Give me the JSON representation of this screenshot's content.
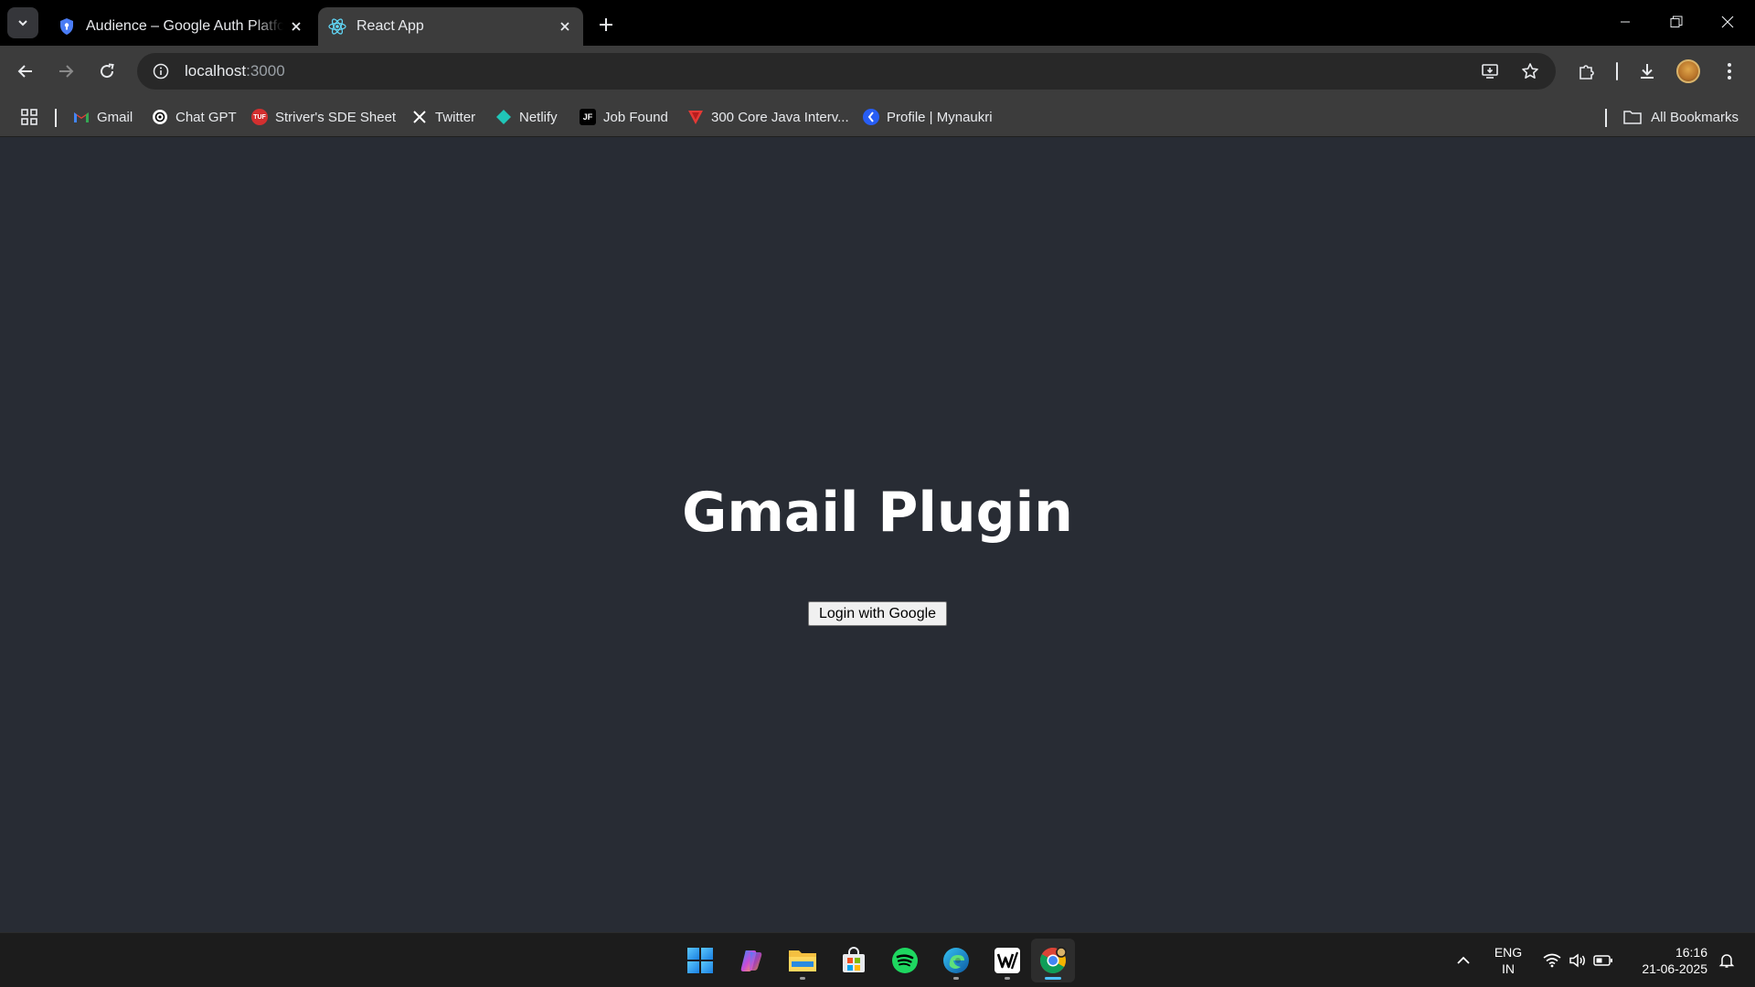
{
  "browser": {
    "tabs": [
      {
        "title": "Audience – Google Auth Platform",
        "favicon": "shield-icon",
        "active": false
      },
      {
        "title": "React App",
        "favicon": "react-icon",
        "active": true
      }
    ],
    "url_host": "localhost",
    "url_port": ":3000",
    "bookmarks": [
      {
        "label": "Gmail",
        "icon": "gmail-icon"
      },
      {
        "label": "Chat GPT",
        "icon": "chatgpt-icon"
      },
      {
        "label": "Striver's SDE Sheet",
        "icon": "tuf-icon"
      },
      {
        "label": "Twitter",
        "icon": "x-icon"
      },
      {
        "label": "Netlify",
        "icon": "netlify-icon"
      },
      {
        "label": "Job Found",
        "icon": "jf-icon"
      },
      {
        "label": "300 Core Java Interv...",
        "icon": "java-icon"
      },
      {
        "label": "Profile | Mynaukri",
        "icon": "naukri-icon"
      }
    ],
    "all_bookmarks": "All Bookmarks"
  },
  "page": {
    "title": "Gmail Plugin",
    "login_button": "Login with Google",
    "background": "#282c34"
  },
  "taskbar": {
    "apps": [
      "start-icon",
      "copilot-icon",
      "file-explorer-icon",
      "microsoft-store-icon",
      "spotify-icon",
      "edge-icon",
      "wps-icon",
      "chrome-icon"
    ],
    "lang_line1": "ENG",
    "lang_line2": "IN",
    "time": "16:16",
    "date": "21-06-2025"
  }
}
